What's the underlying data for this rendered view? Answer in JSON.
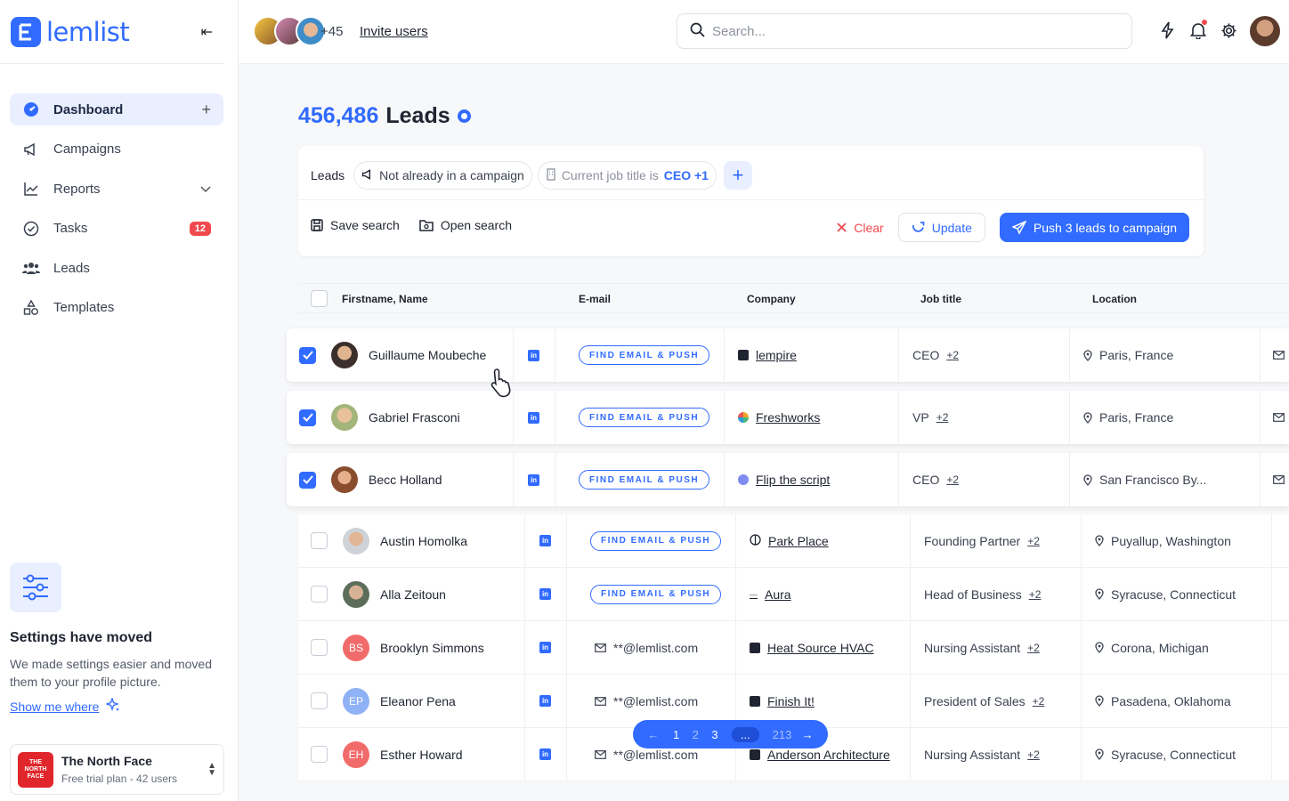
{
  "app": {
    "brand": "lemlist",
    "accent": "#316bff"
  },
  "sidebar": {
    "items": [
      {
        "label": "Dashboard",
        "icon": "dashboard-icon",
        "active": true
      },
      {
        "label": "Campaigns",
        "icon": "megaphone-icon"
      },
      {
        "label": "Reports",
        "icon": "chart-icon"
      },
      {
        "label": "Tasks",
        "icon": "check-circle-icon",
        "badge": "12"
      },
      {
        "label": "Leads",
        "icon": "people-icon"
      },
      {
        "label": "Templates",
        "icon": "shapes-icon"
      }
    ],
    "settings_card": {
      "title": "Settings have moved",
      "text": "We made settings easier and moved them to your profile picture.",
      "link": "Show me where"
    },
    "workspace": {
      "name": "The North Face",
      "plan": "Free trial plan - 42 users",
      "logo_text": "THE NORTH FACE"
    }
  },
  "topbar": {
    "extra_users": "+45",
    "invite": "Invite users",
    "search_placeholder": "Search..."
  },
  "main": {
    "count": "456,486",
    "title_suffix": "Leads",
    "filters": {
      "label": "Leads",
      "chip1": "Not already in a campaign",
      "chip2_prefix": "Current job title is",
      "chip2_value": "CEO +1"
    },
    "actions": {
      "save": "Save search",
      "open": "Open search",
      "clear": "Clear",
      "update": "Update",
      "push": "Push 3 leads to campaign"
    },
    "columns": [
      "Firstname, Name",
      "E-mail",
      "Company",
      "Job title",
      "Location"
    ],
    "find_label": "FIND EMAIL & PUSH",
    "rows": [
      {
        "name": "Guillaume Moubeche",
        "email": "",
        "company": "lempire",
        "job": "CEO",
        "more": "+2",
        "location": "Paris, France",
        "selected": true
      },
      {
        "name": "Gabriel Frasconi",
        "email": "",
        "company": "Freshworks",
        "job": "VP",
        "more": "+2",
        "location": "Paris, France",
        "selected": true
      },
      {
        "name": "Becc Holland",
        "email": "",
        "company": "Flip the script",
        "job": "CEO",
        "more": "+2",
        "location": "San Francisco By...",
        "selected": true
      },
      {
        "name": "Austin Homolka",
        "email": "",
        "company": "Park Place",
        "job": "Founding Partner",
        "more": "+2",
        "location": "Puyallup, Washington",
        "selected": false
      },
      {
        "name": "Alla Zeitoun",
        "email": "",
        "company": "Aura",
        "job": "Head of Business",
        "more": "+2",
        "location": "Syracuse, Connecticut",
        "selected": false
      },
      {
        "name": "Brooklyn Simmons",
        "initials": "BS",
        "email": "**@lemlist.com",
        "company": "Heat Source HVAC",
        "job": "Nursing Assistant",
        "more": "+2",
        "location": "Corona, Michigan",
        "selected": false
      },
      {
        "name": "Eleanor Pena",
        "initials": "EP",
        "email": "**@lemlist.com",
        "company": "Finish It!",
        "job": "President of Sales",
        "more": "+2",
        "location": "Pasadena, Oklahoma",
        "selected": false
      },
      {
        "name": "Esther Howard",
        "initials": "EH",
        "email": "**@lemlist.com",
        "company": "Anderson Architecture",
        "job": "Nursing Assistant",
        "more": "+2",
        "location": "Syracuse, Connecticut",
        "selected": false
      }
    ],
    "pagination": {
      "pages": [
        "1",
        "2",
        "3"
      ],
      "ellipsis": "...",
      "last": "213"
    }
  }
}
